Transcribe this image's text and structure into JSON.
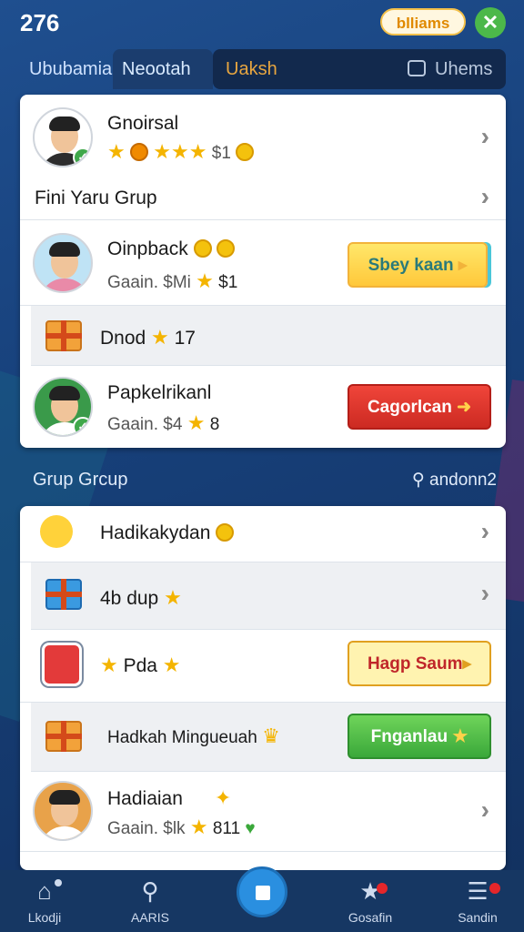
{
  "status": {
    "time": "276",
    "pill": "blliams"
  },
  "tabs": [
    "Ububamia",
    "Neootah",
    "Uaksh",
    "Uhems"
  ],
  "panel1": {
    "row1": {
      "title": "Gnoirsal",
      "amount": "$1"
    },
    "row2": {
      "title": "Fini Yaru Grup"
    },
    "row3": {
      "title": "Oinpback",
      "sub": "Gaain. $Mi",
      "value": "$1",
      "button": "Sbey kaan"
    },
    "row4": {
      "title": "Dnod",
      "value": "17"
    },
    "row5": {
      "title": "Papkelrikanl",
      "sub": "Gaain. $4",
      "value": "8",
      "button": "Cagorlcan"
    }
  },
  "section": {
    "title": "Grup Grcup",
    "right": "andonn2"
  },
  "panel2": {
    "row1": {
      "title": "Hadikakydan"
    },
    "row2": {
      "title": "4b dup"
    },
    "row3": {
      "title": "Pda",
      "button": "Hagp Saum"
    },
    "row4": {
      "title": "Hadkah Mingueuah",
      "button": "Fnganlau"
    },
    "row5": {
      "title": "Hadiaian",
      "sub": "Gaain. $lk",
      "value": "811"
    }
  },
  "nav": [
    "Lkodji",
    "AARIS",
    "Gosafin",
    "Sandin"
  ],
  "colors": {
    "accent": "#2a8fe0",
    "green": "#3aa83a",
    "red": "#cc2a22",
    "yellow": "#ffc83a"
  }
}
